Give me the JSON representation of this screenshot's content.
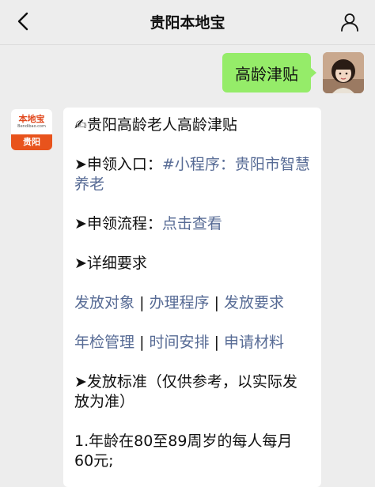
{
  "header": {
    "title": "贵阳本地宝"
  },
  "outgoing": {
    "text": "高龄津贴"
  },
  "bot": {
    "logo_main": "本地宝",
    "logo_sub": "Bendibao.com",
    "logo_city": "贵阳"
  },
  "message": {
    "heading_emoji": "✍",
    "heading": "贵阳高龄老人高龄津贴",
    "apply_entry_label": "➤申领入口：",
    "apply_entry_link": "#小程序：贵阳市智慧养老",
    "apply_flow_label": "➤申领流程：",
    "apply_flow_link": "点击查看",
    "details_label": "➤详细要求",
    "links_row1": [
      "发放对象",
      "办理程序",
      "发放要求"
    ],
    "links_row2": [
      "年检管理",
      "时间安排",
      "申请材料"
    ],
    "standard_label": "➤发放标准（仅供参考，以实际发放为准）",
    "standard_item1": "1.年龄在80至89周岁的每人每月60元;"
  }
}
